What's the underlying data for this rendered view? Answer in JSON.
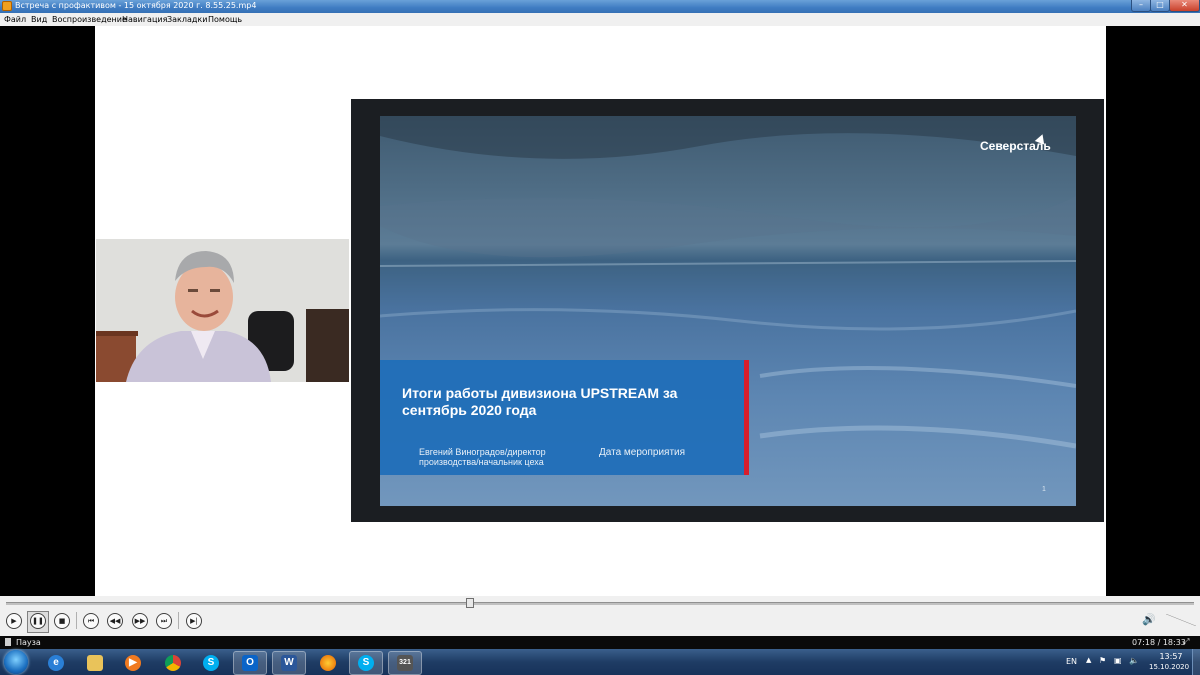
{
  "window": {
    "title": "Встреча с профактивом - 15 октября 2020 г. 8.55.25.mp4",
    "min_icon": "minimize-icon",
    "max_icon": "maximize-icon",
    "close_icon": "close-icon"
  },
  "menu": {
    "items": [
      "Файл",
      "Вид",
      "Воспроизведение",
      "Навигация",
      "Закладки",
      "Помощь"
    ]
  },
  "slide": {
    "title": "Итоги работы дивизиона UPSTREAM за сентябрь 2020 года",
    "author": "Евгений Виноградов/директор производства/начальник цеха",
    "date_placeholder": "Дата мероприятия",
    "logo": "Северсталь",
    "page_number": "1",
    "band_color": "#1e6eb9",
    "accent_color": "#d81e2c"
  },
  "player": {
    "seek_progress": 0.39,
    "controls": [
      "play-icon",
      "pause-icon",
      "stop-icon",
      "skip-start-icon",
      "rewind-icon",
      "forward-icon",
      "skip-end-icon",
      "frame-step-icon"
    ],
    "volume_icon": "speaker-icon"
  },
  "status": {
    "state": "Пауза",
    "time": "07:18 / 18:33"
  },
  "taskbar": {
    "apps": [
      "internet-explorer-icon",
      "file-explorer-icon",
      "media-player-icon",
      "chrome-icon",
      "skype-icon",
      "outlook-icon",
      "word-icon",
      "firefox-icon",
      "skype-icon",
      "media-player-classic-icon"
    ],
    "lang": "EN",
    "clock_time": "13:57",
    "clock_date": "15.10.2020"
  }
}
